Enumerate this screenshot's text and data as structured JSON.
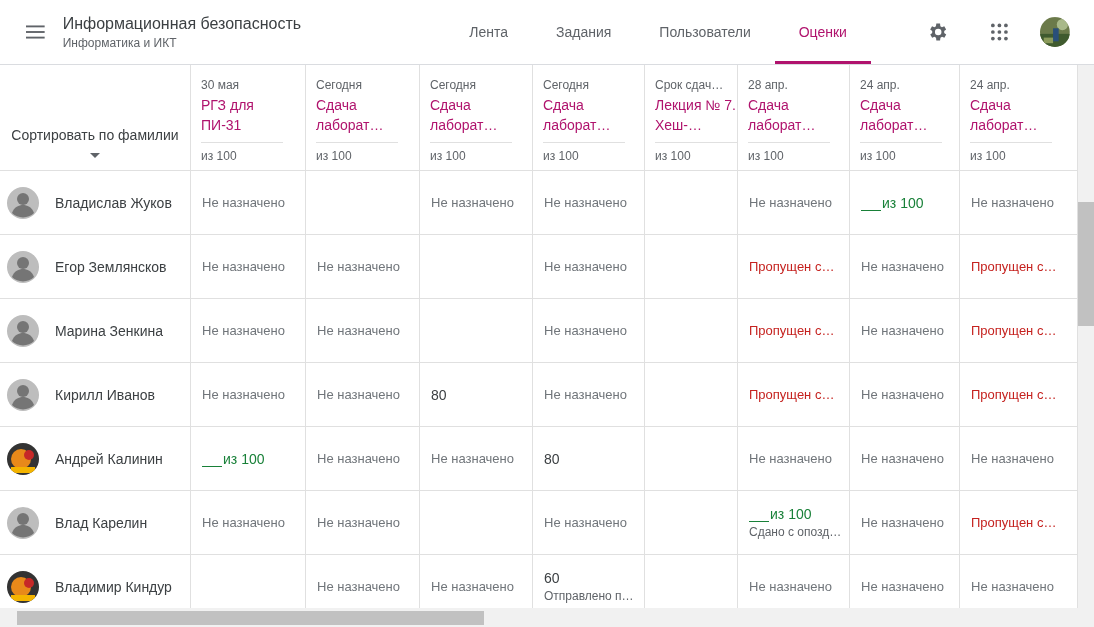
{
  "header": {
    "title": "Информационная безопасность",
    "subtitle": "Информатика и ИКТ"
  },
  "tabs": [
    {
      "label": "Лента",
      "selected": false
    },
    {
      "label": "Задания",
      "selected": false
    },
    {
      "label": "Пользователи",
      "selected": false
    },
    {
      "label": "Оценки",
      "selected": true
    }
  ],
  "sort": {
    "label": "Сортировать по фамилии"
  },
  "columns": [
    {
      "date": "30 мая",
      "title": "РГЗ для ПИ-31",
      "points": "из 100"
    },
    {
      "date": "Сегодня",
      "title": "Сдача лаборат…",
      "points": "из 100"
    },
    {
      "date": "Сегодня",
      "title": "Сдача лаборат…",
      "points": "из 100"
    },
    {
      "date": "Сегодня",
      "title": "Сдача лаборат…",
      "points": "из 100"
    },
    {
      "date": "Срок сдач…",
      "title": "Лекция № 7. Хеш-…",
      "points": "из 100"
    },
    {
      "date": "28 апр.",
      "title": "Сдача лаборат…",
      "points": "из 100"
    },
    {
      "date": "24 апр.",
      "title": "Сдача лаборат…",
      "points": "из 100"
    },
    {
      "date": "24 апр.",
      "title": "Сдача лаборат…",
      "points": "из 100"
    }
  ],
  "students": [
    {
      "name": "Владислав Жуков",
      "avatar": {
        "kind": "default"
      },
      "cells": [
        {
          "kind": "missing",
          "text": "Не назначено"
        },
        {
          "kind": "empty"
        },
        {
          "kind": "missing",
          "text": "Не назначено"
        },
        {
          "kind": "missing",
          "text": "Не назначено"
        },
        {
          "kind": "empty"
        },
        {
          "kind": "missing",
          "text": "Не назначено"
        },
        {
          "kind": "draft",
          "text": "из 100"
        },
        {
          "kind": "missing",
          "text": "Не назначено"
        }
      ]
    },
    {
      "name": "Егор Землянсков",
      "avatar": {
        "kind": "default"
      },
      "cells": [
        {
          "kind": "missing",
          "text": "Не назначено"
        },
        {
          "kind": "missing",
          "text": "Не назначено"
        },
        {
          "kind": "empty"
        },
        {
          "kind": "missing",
          "text": "Не назначено"
        },
        {
          "kind": "empty"
        },
        {
          "kind": "late",
          "text": "Пропущен с…"
        },
        {
          "kind": "missing",
          "text": "Не назначено"
        },
        {
          "kind": "late",
          "text": "Пропущен с…"
        }
      ]
    },
    {
      "name": "Марина Зенкина",
      "avatar": {
        "kind": "default"
      },
      "cells": [
        {
          "kind": "missing",
          "text": "Не назначено"
        },
        {
          "kind": "missing",
          "text": "Не назначено"
        },
        {
          "kind": "empty"
        },
        {
          "kind": "missing",
          "text": "Не назначено"
        },
        {
          "kind": "empty"
        },
        {
          "kind": "late",
          "text": "Пропущен с…"
        },
        {
          "kind": "missing",
          "text": "Не назначено"
        },
        {
          "kind": "late",
          "text": "Пропущен с…"
        }
      ]
    },
    {
      "name": "Кирилл Иванов",
      "avatar": {
        "kind": "default"
      },
      "cells": [
        {
          "kind": "missing",
          "text": "Не назначено"
        },
        {
          "kind": "missing",
          "text": "Не назначено"
        },
        {
          "kind": "grade",
          "text": "80"
        },
        {
          "kind": "missing",
          "text": "Не назначено"
        },
        {
          "kind": "empty"
        },
        {
          "kind": "late",
          "text": "Пропущен с…"
        },
        {
          "kind": "missing",
          "text": "Не назначено"
        },
        {
          "kind": "late",
          "text": "Пропущен с…"
        }
      ]
    },
    {
      "name": "Андрей Калинин",
      "cells": [
        {
          "kind": "draft",
          "text": "из 100"
        },
        {
          "kind": "missing",
          "text": "Не назначено"
        },
        {
          "kind": "missing",
          "text": "Не назначено"
        },
        {
          "kind": "grade",
          "text": "80"
        },
        {
          "kind": "empty"
        },
        {
          "kind": "missing",
          "text": "Не назначено"
        },
        {
          "kind": "missing",
          "text": "Не назначено"
        },
        {
          "kind": "missing",
          "text": "Не назначено"
        }
      ]
    },
    {
      "name": "Влад Карелин",
      "avatar": {
        "kind": "default"
      },
      "cells": [
        {
          "kind": "missing",
          "text": "Не назначено"
        },
        {
          "kind": "missing",
          "text": "Не назначено"
        },
        {
          "kind": "empty"
        },
        {
          "kind": "missing",
          "text": "Не назначено"
        },
        {
          "kind": "empty"
        },
        {
          "kind": "draft",
          "text": "из 100",
          "note": "Сдано с опозд…"
        },
        {
          "kind": "missing",
          "text": "Не назначено"
        },
        {
          "kind": "late",
          "text": "Пропущен с…"
        }
      ]
    },
    {
      "name": "Владимир Киндур",
      "cells": [
        {
          "kind": "empty"
        },
        {
          "kind": "missing",
          "text": "Не назначено"
        },
        {
          "kind": "missing",
          "text": "Не назначено"
        },
        {
          "kind": "grade",
          "text": "60",
          "note": "Отправлено п…"
        },
        {
          "kind": "empty"
        },
        {
          "kind": "missing",
          "text": "Не назначено"
        },
        {
          "kind": "missing",
          "text": "Не назначено"
        },
        {
          "kind": "missing",
          "text": "Не назначено"
        }
      ]
    }
  ]
}
